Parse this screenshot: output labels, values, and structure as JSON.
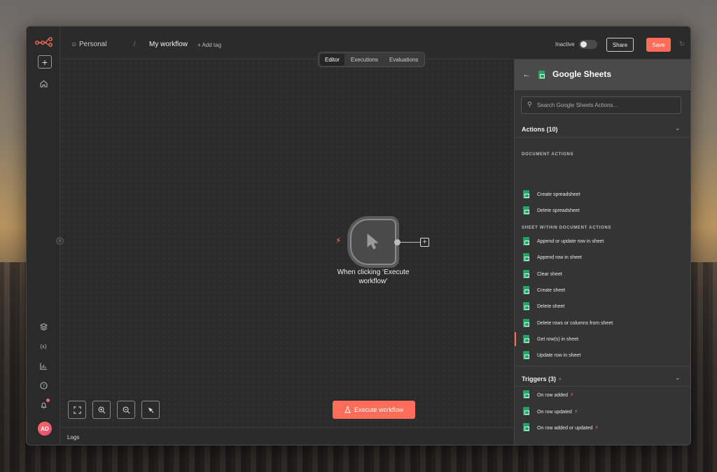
{
  "header": {
    "project": "Personal",
    "workflow_name": "My workflow",
    "add_tag": "+ Add tag",
    "status_label": "Inactive",
    "share_label": "Share",
    "save_label": "Save",
    "more_label": "···"
  },
  "tabs": [
    {
      "label": "Editor",
      "active": true
    },
    {
      "label": "Executions",
      "active": false
    },
    {
      "label": "Evaluations",
      "active": false
    }
  ],
  "rail": {
    "avatar_initials": "AD"
  },
  "canvas": {
    "node_label": "When clicking ‘Execute workflow’",
    "execute_label": "Execute workflow",
    "logs_label": "Logs"
  },
  "panel": {
    "title": "Google Sheets",
    "search_placeholder": "Search Google Sheets Actions...",
    "actions_title": "Actions (10)",
    "groups": [
      {
        "label": "DOCUMENT ACTIONS",
        "items": [
          "Create spreadsheet",
          "Delete spreadsheet"
        ]
      },
      {
        "label": "SHEET WITHIN DOCUMENT ACTIONS",
        "items": [
          "Append or update row in sheet",
          "Append row in sheet",
          "Clear sheet",
          "Create sheet",
          "Delete sheet",
          "Delete rows or columns from sheet",
          "Get row(s) in sheet",
          "Update row in sheet"
        ]
      }
    ],
    "selected_item": "Get row(s) in sheet",
    "triggers_title": "Triggers (3)",
    "triggers": [
      "On row added",
      "On row updated",
      "On row added or updated"
    ]
  },
  "colors": {
    "accent": "#ff6d5a",
    "sheets_green": "#21a464",
    "panel_bg": "#343434",
    "canvas_bg": "#2b2b2b"
  }
}
